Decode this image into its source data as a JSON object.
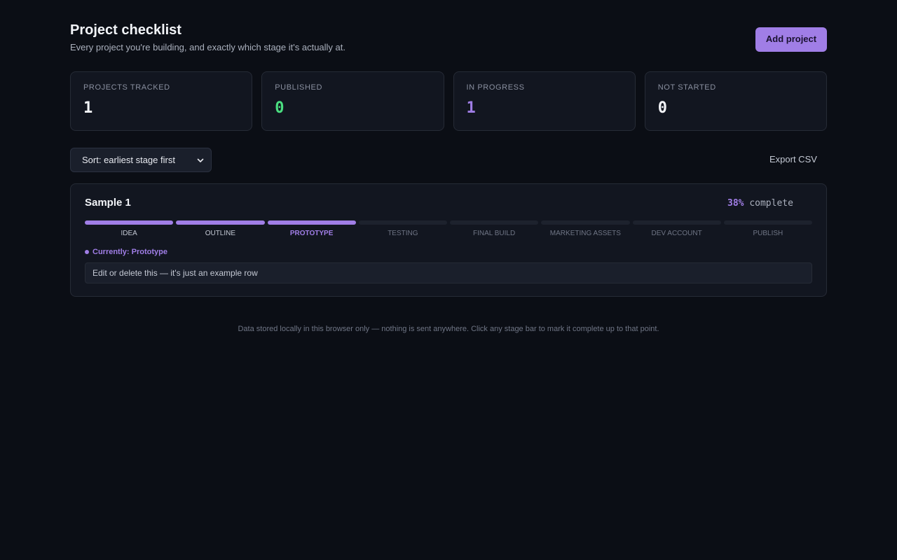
{
  "header": {
    "title": "Project checklist",
    "subtitle": "Every project you're building, and exactly which stage it's actually at.",
    "add_button": "Add project"
  },
  "stats": [
    {
      "label": "PROJECTS TRACKED",
      "value": "1",
      "color": "#f2f4f8"
    },
    {
      "label": "PUBLISHED",
      "value": "0",
      "color": "#4ade80"
    },
    {
      "label": "IN PROGRESS",
      "value": "1",
      "color": "#a07ee6"
    },
    {
      "label": "NOT STARTED",
      "value": "0",
      "color": "#f2f4f8"
    }
  ],
  "toolbar": {
    "sort_selected": "Sort: earliest stage first",
    "export_label": "Export CSV"
  },
  "project": {
    "name": "Sample 1",
    "percent": "38%",
    "percent_word": "complete",
    "stages": [
      {
        "label": "IDEA",
        "done": true,
        "current": false
      },
      {
        "label": "OUTLINE",
        "done": true,
        "current": false
      },
      {
        "label": "PROTOTYPE",
        "done": true,
        "current": true
      },
      {
        "label": "TESTING",
        "done": false,
        "current": false
      },
      {
        "label": "FINAL BUILD",
        "done": false,
        "current": false
      },
      {
        "label": "MARKETING ASSETS",
        "done": false,
        "current": false
      },
      {
        "label": "DEV ACCOUNT",
        "done": false,
        "current": false
      },
      {
        "label": "PUBLISH",
        "done": false,
        "current": false
      }
    ],
    "current_label": "Currently: Prototype",
    "note_value": "Edit or delete this — it's just an example row"
  },
  "footer": "Data stored locally in this browser only — nothing is sent anywhere. Click any stage bar to mark it complete up to that point.",
  "colors": {
    "accent": "#a07ee6",
    "published": "#4ade80",
    "background": "#0b0e15",
    "card": "#121620"
  }
}
